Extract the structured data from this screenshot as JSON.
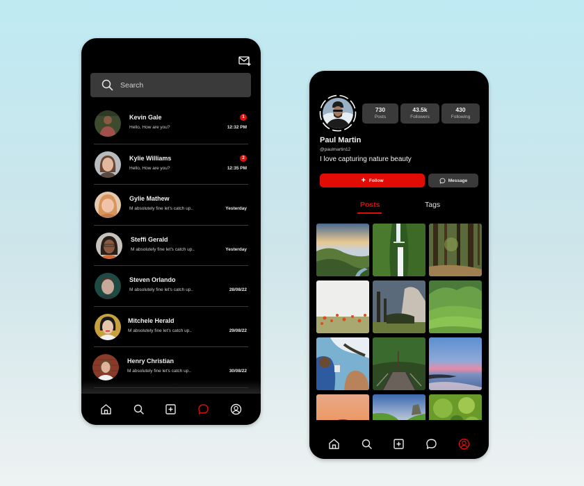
{
  "messages_screen": {
    "compose_icon": "mail-plus-icon",
    "search": {
      "placeholder": "Search",
      "icon": "search-icon"
    },
    "chats": [
      {
        "name": "Kevin Gale",
        "preview": "Hello, How are you?",
        "time": "12:32 PM",
        "unread": "1"
      },
      {
        "name": "Kylie Williams",
        "preview": "Hello, How are you?",
        "time": "12:35 PM",
        "unread": "2"
      },
      {
        "name": "Gylie Mathew",
        "preview": "M absolutely fine let's catch up..",
        "time": "Yesterday",
        "unread": null
      },
      {
        "name": "Steffi Gerald",
        "preview": "M absolutely fine let's catch up..",
        "time": "Yesterday",
        "unread": null
      },
      {
        "name": "Steven Orlando",
        "preview": "M absolutely fine let's catch up..",
        "time": "28/08/22",
        "unread": null
      },
      {
        "name": "Mitchele Herald",
        "preview": "M absolutely fine let's catch up..",
        "time": "29/08/22",
        "unread": null
      },
      {
        "name": "Henry Christian",
        "preview": "M absolutely fine let's catch up..",
        "time": "30/08/22",
        "unread": null
      }
    ],
    "bottom_nav": {
      "items": [
        "home-icon",
        "search-icon",
        "add-post-icon",
        "chat-icon",
        "profile-icon"
      ],
      "active": "chat-icon"
    }
  },
  "profile_screen": {
    "name": "Paul Martin",
    "handle": "@paulmartin12",
    "bio": "I love capturing nature beauty",
    "stats": [
      {
        "value": "730",
        "label": "Posts"
      },
      {
        "value": "43.5k",
        "label": "Followers"
      },
      {
        "value": "430",
        "label": "Following"
      }
    ],
    "follow_label": "Follow",
    "message_label": "Message",
    "tabs": [
      {
        "label": "Posts",
        "active": true
      },
      {
        "label": "Tags",
        "active": false
      }
    ],
    "posts": [
      "misty-mountain-valley",
      "waterfall-bridge",
      "redwood-forest",
      "poppy-field",
      "granite-cliff-meadow",
      "green-hills",
      "coastal-friends",
      "forest-footbridge",
      "pink-sunset-beach",
      "orange-sunset-tree",
      "green-valley-sunrise",
      "leafy-foliage"
    ],
    "bottom_nav": {
      "items": [
        "home-icon",
        "search-icon",
        "add-post-icon",
        "chat-icon",
        "profile-icon"
      ],
      "active": "profile-icon"
    }
  },
  "colors": {
    "accent": "#e10c05",
    "surface": "#3a3a3a",
    "background": "#000000"
  }
}
